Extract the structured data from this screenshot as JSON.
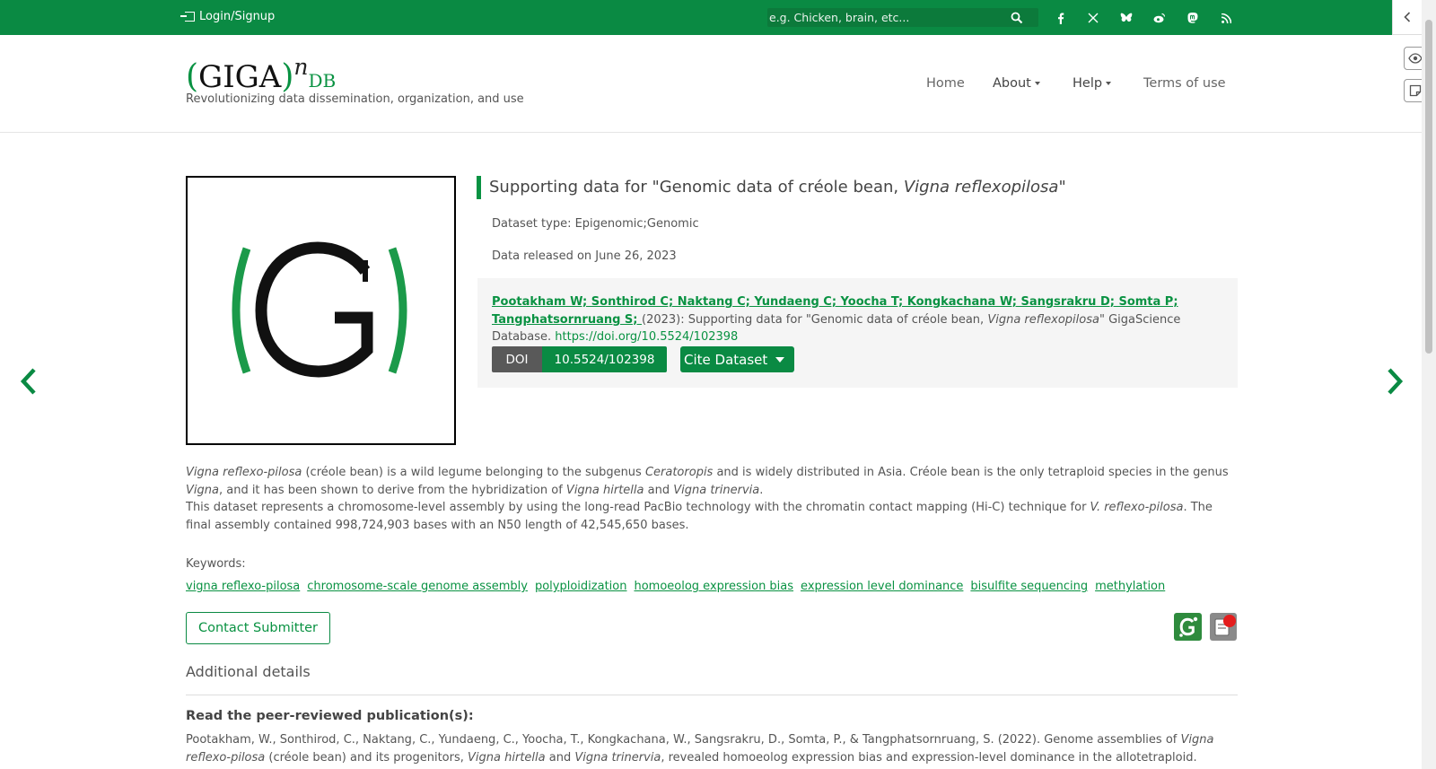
{
  "topbar": {
    "login_label": "Login/Signup",
    "search_placeholder": "e.g. Chicken, brain, etc...",
    "social_icons": [
      "facebook-icon",
      "x-icon",
      "bluesky-icon",
      "weibo-icon",
      "mastodon-icon",
      "rss-icon"
    ]
  },
  "header": {
    "logo": {
      "paren_open": "(",
      "giga": "GIGA",
      "paren_close": ")",
      "n": "n",
      "db": "DB"
    },
    "tagline": "Revolutionizing data dissemination, organization, and use",
    "nav": {
      "home": "Home",
      "about": "About",
      "help": "Help",
      "terms": "Terms of use"
    }
  },
  "dataset": {
    "title_prefix": "Supporting data for \"Genomic data of créole bean, ",
    "title_species": "Vigna reflexopilosa",
    "title_suffix": "\"",
    "type_line": "Dataset type: Epigenomic;Genomic",
    "release_line": "Data released on June 26, 2023",
    "citation": {
      "authors": "Pootakham W; Sonthirod C; Naktang C; Yundaeng C; Yoocha T; Kongkachana W; Sangsrakru D; Somta P; Tangphatsornruang S; ",
      "text1": "(2023): Supporting data for \"Genomic data of créole bean, ",
      "species": "Vigna reflexopilosa",
      "text2": "\" GigaScience Database. ",
      "doi_url": "https://doi.org/10.5524/102398"
    },
    "doi_label": "DOI",
    "doi_value": "10.5524/102398",
    "cite_button": "Cite Dataset",
    "description": {
      "p1_s1": "Vigna reflexo-pilosa",
      "p1_t1": " (créole bean) is a wild legume belonging to the subgenus ",
      "p1_s2": "Ceratoropis",
      "p1_t2": " and is widely distributed in Asia. Créole bean is the only tetraploid species in the genus ",
      "p1_s3": "Vigna",
      "p1_t3": ", and it has been shown to derive from the hybridization of ",
      "p1_s4": "Vigna hirtella",
      "p1_t4": " and ",
      "p1_s5": "Vigna trinervia",
      "p1_t5": ".",
      "p2_t1": "This dataset represents a chromosome-level assembly by using the long-read PacBio technology with the chromatin contact mapping (Hi-C) technique for ",
      "p2_s1": "V. reflexo-pilosa",
      "p2_t2": ". The final assembly contained 998,724,903 bases with an N50 length of 42,545,650 bases."
    },
    "keywords_label": "Keywords:",
    "keywords": [
      "vigna reflexo-pilosa",
      "chromosome-scale genome assembly",
      "polyploidization",
      "homoeolog expression bias",
      "expression level dominance",
      "bisulfite sequencing",
      "methylation"
    ],
    "contact_button": "Contact Submitter",
    "additional_details": "Additional details",
    "pub_heading": "Read the peer-reviewed publication(s):",
    "publication": {
      "t1": "Pootakham, W., Sonthirod, C., Naktang, C., Yundaeng, C., Yoocha, T., Kongkachana, W., Sangsrakru, D., Somta, P., & Tangphatsornruang, S. (2022). Genome assemblies of ",
      "s1": "Vigna reflexo-pilosa",
      "t2": " (créole bean) and its progenitors, ",
      "s2": "Vigna hirtella",
      "t3": " and ",
      "s3": "Vigna trinervia",
      "t4": ", revealed homoeolog expression bias and expression-level dominance in the allotetraploid."
    }
  },
  "colors": {
    "brand_green": "#0a8a43",
    "link_green": "#099242",
    "doi_gray": "#595959"
  }
}
